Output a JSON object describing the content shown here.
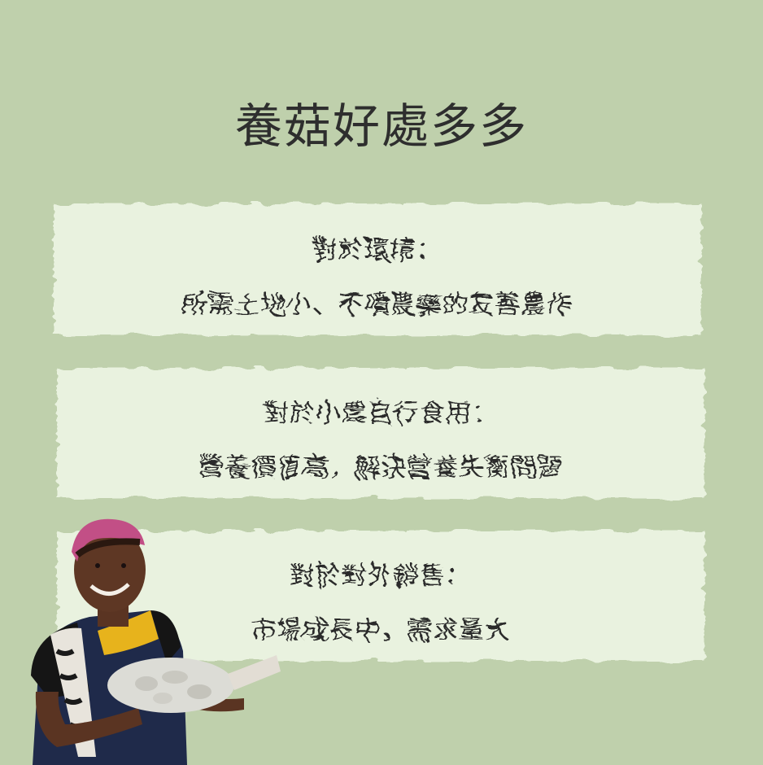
{
  "title": "養菇好處多多",
  "benefits": [
    {
      "heading": "對於環境：",
      "detail": "所需土地小、不噴農藥的友善農作"
    },
    {
      "heading": "對於小農自行食用：",
      "detail": "營養價值高，解決營養失衡問題"
    },
    {
      "heading": "對於對外銷售：",
      "detail": "市場成長中，需求量大"
    }
  ],
  "colors": {
    "background": "#bfd0ac",
    "card": "#e9f2df",
    "text": "#2a2a2a"
  }
}
